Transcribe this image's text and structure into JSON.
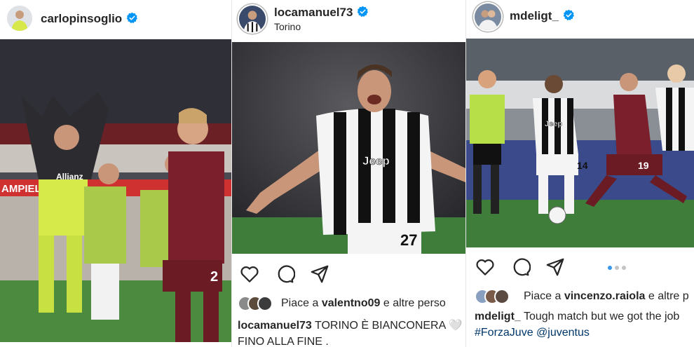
{
  "posts": [
    {
      "username": "carlopinsoglio",
      "location": "",
      "verified": true,
      "likes_prefix": "",
      "likes_user": "",
      "likes_suffix": "",
      "caption_user": "",
      "caption_text": "",
      "caption_line2": "",
      "hashtags": "",
      "mention": ""
    },
    {
      "username": "locamanuel73",
      "location": "Torino",
      "verified": true,
      "likes_prefix": "Piace a ",
      "likes_user": "valentno09",
      "likes_suffix": " e altre perso",
      "caption_user": "locamanuel73",
      "caption_text": "TORINO È BIANCONERA 🤍",
      "caption_line2": "FINO ALLA FINE .",
      "hashtags": "",
      "mention": ""
    },
    {
      "username": "mdeligt_",
      "location": "",
      "verified": true,
      "likes_prefix": "Piace a ",
      "likes_user": "vincenzo.raiola",
      "likes_suffix": " e altre p",
      "caption_user": "mdeligt_",
      "caption_text": "Tough match but we got the job",
      "caption_line2": "",
      "hashtags": "#ForzaJuve",
      "mention": "@juventus"
    }
  ],
  "jersey_text": {
    "sponsor": "Jeep",
    "sponsor_back": "Allianz",
    "number_a": "27",
    "number_b": "14",
    "number_c": "19",
    "number_d": "2",
    "banner": "AMPIELLO"
  },
  "colors": {
    "verified": "#0095f6",
    "link": "#00376b",
    "torino": "#7a1f2b",
    "keeper": "#c8e63c",
    "pitch": "#3f7d3a",
    "carousel_active": "#3897f0"
  },
  "icons": [
    "heart-icon",
    "comment-icon",
    "share-icon",
    "verified-badge-icon"
  ],
  "carousel": {
    "count": 3,
    "active_index": 0
  }
}
